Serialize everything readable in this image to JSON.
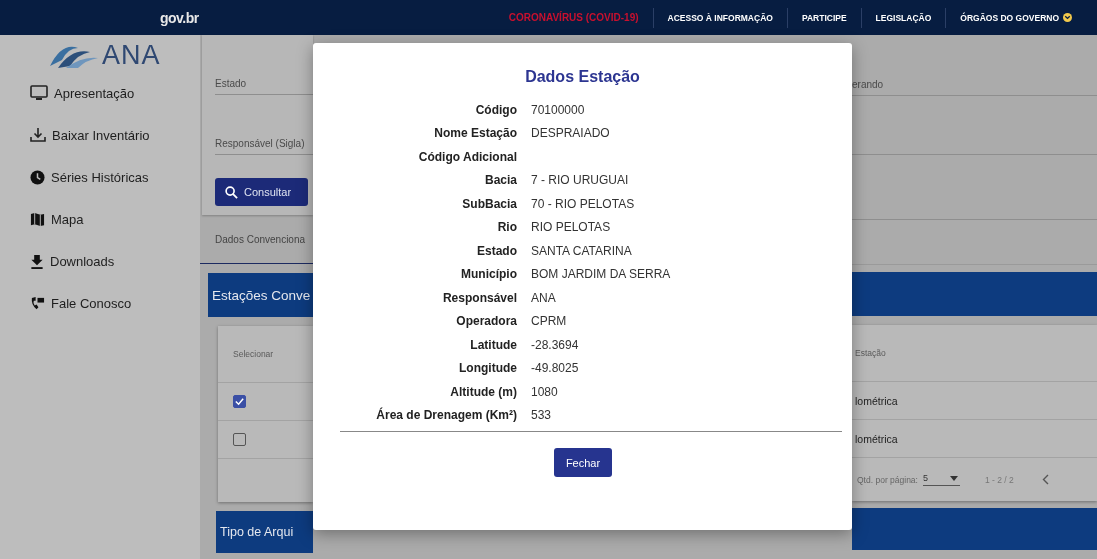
{
  "top_bar": {
    "logo": "gov.br",
    "links": [
      {
        "label": "CORONAVÍRUS (COVID-19)",
        "kind": "alert"
      },
      {
        "label": "ACESSO À INFORMAÇÃO",
        "kind": "link"
      },
      {
        "label": "PARTICIPE",
        "kind": "link"
      },
      {
        "label": "LEGISLAÇÃO",
        "kind": "link"
      },
      {
        "label": "ÓRGÃOS DO GOVERNO",
        "kind": "dropdown"
      }
    ]
  },
  "sidebar": {
    "logo": "ANA",
    "items": [
      {
        "label": "Apresentação"
      },
      {
        "label": "Baixar Inventário"
      },
      {
        "label": "Séries Históricas"
      },
      {
        "label": "Mapa"
      },
      {
        "label": "Downloads"
      },
      {
        "label": "Fale Conosco"
      }
    ]
  },
  "search_form": {
    "left_fields": [
      {
        "label": "Estado"
      },
      {
        "label": "Responsável (Sigla)"
      }
    ],
    "right_fields": [
      {
        "label": "erando"
      }
    ],
    "button": "Consultar"
  },
  "tabs": [
    {
      "label": "Dados Convenciona",
      "selected": true
    }
  ],
  "stations_panel": {
    "title": "Estações Conve",
    "columns": [
      "Selecionar",
      "Estação"
    ],
    "rows": [
      {
        "selected": true,
        "cell": "lométrica"
      },
      {
        "selected": false,
        "cell": "lométrica"
      }
    ],
    "pagination": {
      "per_page_label": "Qtd. por página:",
      "per_page": "5",
      "range": "1 - 2 / 2"
    }
  },
  "file_type_panel": {
    "title": "Tipo de Arqui"
  },
  "dialog": {
    "title": "Dados Estação",
    "fields": [
      {
        "label": "Código",
        "value": "70100000"
      },
      {
        "label": "Nome Estação",
        "value": "DESPRAIADO"
      },
      {
        "label": "Código Adicional"
      },
      {
        "label": "Bacia",
        "value": "7 - RIO URUGUAI"
      },
      {
        "label": "SubBacia",
        "value": "70 - RIO PELOTAS"
      },
      {
        "label": "Rio",
        "value": "RIO PELOTAS"
      },
      {
        "label": "Estado",
        "value": "SANTA CATARINA"
      },
      {
        "label": "Município",
        "value": "BOM JARDIM DA SERRA"
      },
      {
        "label": "Responsável",
        "value": "ANA"
      },
      {
        "label": "Operadora",
        "value": "CPRM"
      },
      {
        "label": "Latitude",
        "value": "-28.3694"
      },
      {
        "label": "Longitude",
        "value": "-49.8025"
      },
      {
        "label": "Altitude (m)",
        "value": "1080"
      },
      {
        "label": "Área de Drenagem (Km²)",
        "value": "533"
      }
    ],
    "button": "Fechar"
  }
}
